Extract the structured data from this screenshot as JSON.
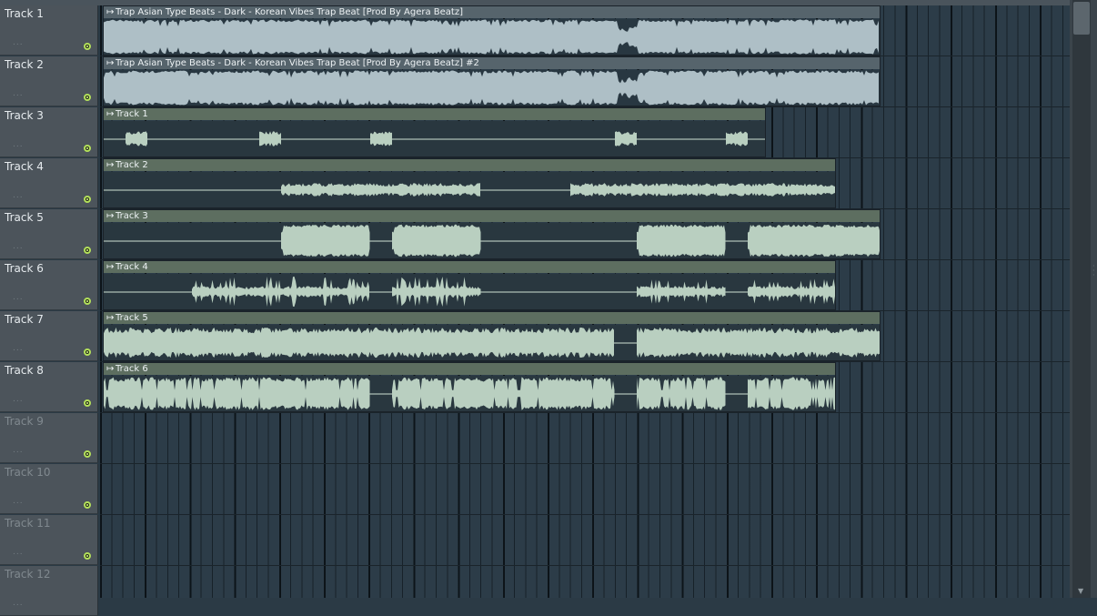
{
  "tracks": [
    {
      "name": "Track 1",
      "dots": "...",
      "active": true
    },
    {
      "name": "Track 2",
      "dots": "...",
      "active": true
    },
    {
      "name": "Track 3",
      "dots": "...",
      "active": true
    },
    {
      "name": "Track 4",
      "dots": "...",
      "active": true
    },
    {
      "name": "Track 5",
      "dots": "...",
      "active": true
    },
    {
      "name": "Track 6",
      "dots": "...",
      "active": true
    },
    {
      "name": "Track 7",
      "dots": "...",
      "active": true
    },
    {
      "name": "Track 8",
      "dots": "...",
      "active": true
    },
    {
      "name": "Track 9",
      "dots": "...",
      "active": false
    },
    {
      "name": "Track 10",
      "dots": "...",
      "active": false
    },
    {
      "name": "Track 11",
      "dots": "...",
      "active": false
    },
    {
      "name": "Track 12",
      "dots": "...",
      "active": false
    }
  ],
  "clips": [
    {
      "label": "Trap Asian Type Beats - Dark - Korean Vibes Trap Beat [Prod By Agera Beatz]",
      "track": 1,
      "style": "audio-main",
      "icon": "play-arrow-icon"
    },
    {
      "label": "Trap Asian Type Beats - Dark - Korean Vibes Trap Beat [Prod By Agera Beatz] #2",
      "track": 2,
      "style": "audio-main",
      "icon": "play-arrow-icon"
    },
    {
      "label": "Track 1",
      "track": 3,
      "style": "stem",
      "icon": "play-arrow-icon"
    },
    {
      "label": "Track 2",
      "track": 4,
      "style": "stem",
      "icon": "play-arrow-icon"
    },
    {
      "label": "Track 3",
      "track": 5,
      "style": "stem",
      "icon": "play-arrow-icon"
    },
    {
      "label": "Track 4",
      "track": 6,
      "style": "stem",
      "icon": "play-arrow-icon"
    },
    {
      "label": "Track 5",
      "track": 7,
      "style": "stem",
      "icon": "play-arrow-icon"
    },
    {
      "label": "Track 6",
      "track": 8,
      "style": "stem",
      "icon": "play-arrow-icon"
    }
  ],
  "colors": {
    "background": "#2b3a45",
    "track_header": "#4c545b",
    "audio_clip_body": "#aebfc6",
    "stem_clip_header": "#5d6e60",
    "stem_wave": "#b9cfc0",
    "mute_led": "#b3e05a"
  }
}
